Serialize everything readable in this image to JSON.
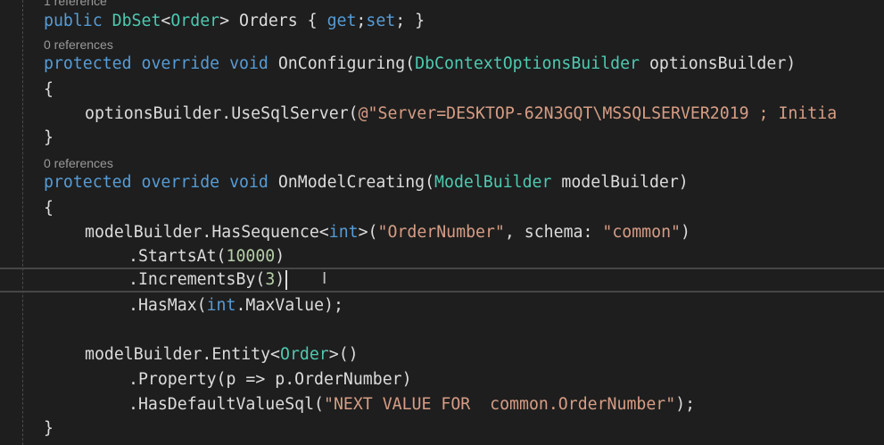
{
  "lens": {
    "l0": "1 reference",
    "l1": "0 references",
    "l2": "0 references"
  },
  "code": {
    "c1": {
      "k1": "public",
      "t1": "DbSet",
      "p1": "<",
      "t2": "Order",
      "p2": "> Orders { ",
      "k2": "get",
      "p3": ";",
      "k3": "set",
      "p4": "; }"
    },
    "c2": {
      "k1": "protected",
      "k2": "override",
      "k3": "void",
      "p1": "OnConfiguring(",
      "t1": "DbContextOptionsBuilder",
      "p2": " optionsBuilder)"
    },
    "c3": {
      "p1": "{"
    },
    "c4": {
      "p1": "optionsBuilder.UseSqlServer(",
      "s1": "@\"Server=DESKTOP-62N3GQT\\MSSQLSERVER2019 ; Initia"
    },
    "c5": {
      "p1": "}"
    },
    "c6": {
      "k1": "protected",
      "k2": "override",
      "k3": "void",
      "p1": "OnModelCreating(",
      "t1": "ModelBuilder",
      "p2": " modelBuilder)"
    },
    "c7": {
      "p1": "{"
    },
    "c8": {
      "p1": "modelBuilder.HasSequence",
      "p2": "<",
      "k1": "int",
      "p3": ">(",
      "s1": "\"OrderNumber\"",
      "p4": ", schema: ",
      "s2": "\"common\"",
      "p5": ")"
    },
    "c9": {
      "p1": ".StartsAt(",
      "n1": "10000",
      "p2": ")"
    },
    "c10": {
      "p1": ".IncrementsBy(",
      "n1": "3",
      "p2": ")"
    },
    "c11": {
      "p1": ".HasMax(",
      "k1": "int",
      "p2": ".MaxValue);"
    },
    "c12": {
      "p1": "modelBuilder.Entity",
      "p2": "<",
      "t1": "Order",
      "p3": ">()"
    },
    "c13": {
      "p1": ".Property(p => p.OrderNumber)"
    },
    "c14": {
      "p1": ".HasDefaultValueSql(",
      "s1": "\"NEXT VALUE FOR  common.OrderNumber\"",
      "p2": ");"
    },
    "c15": {
      "p1": "}"
    }
  }
}
